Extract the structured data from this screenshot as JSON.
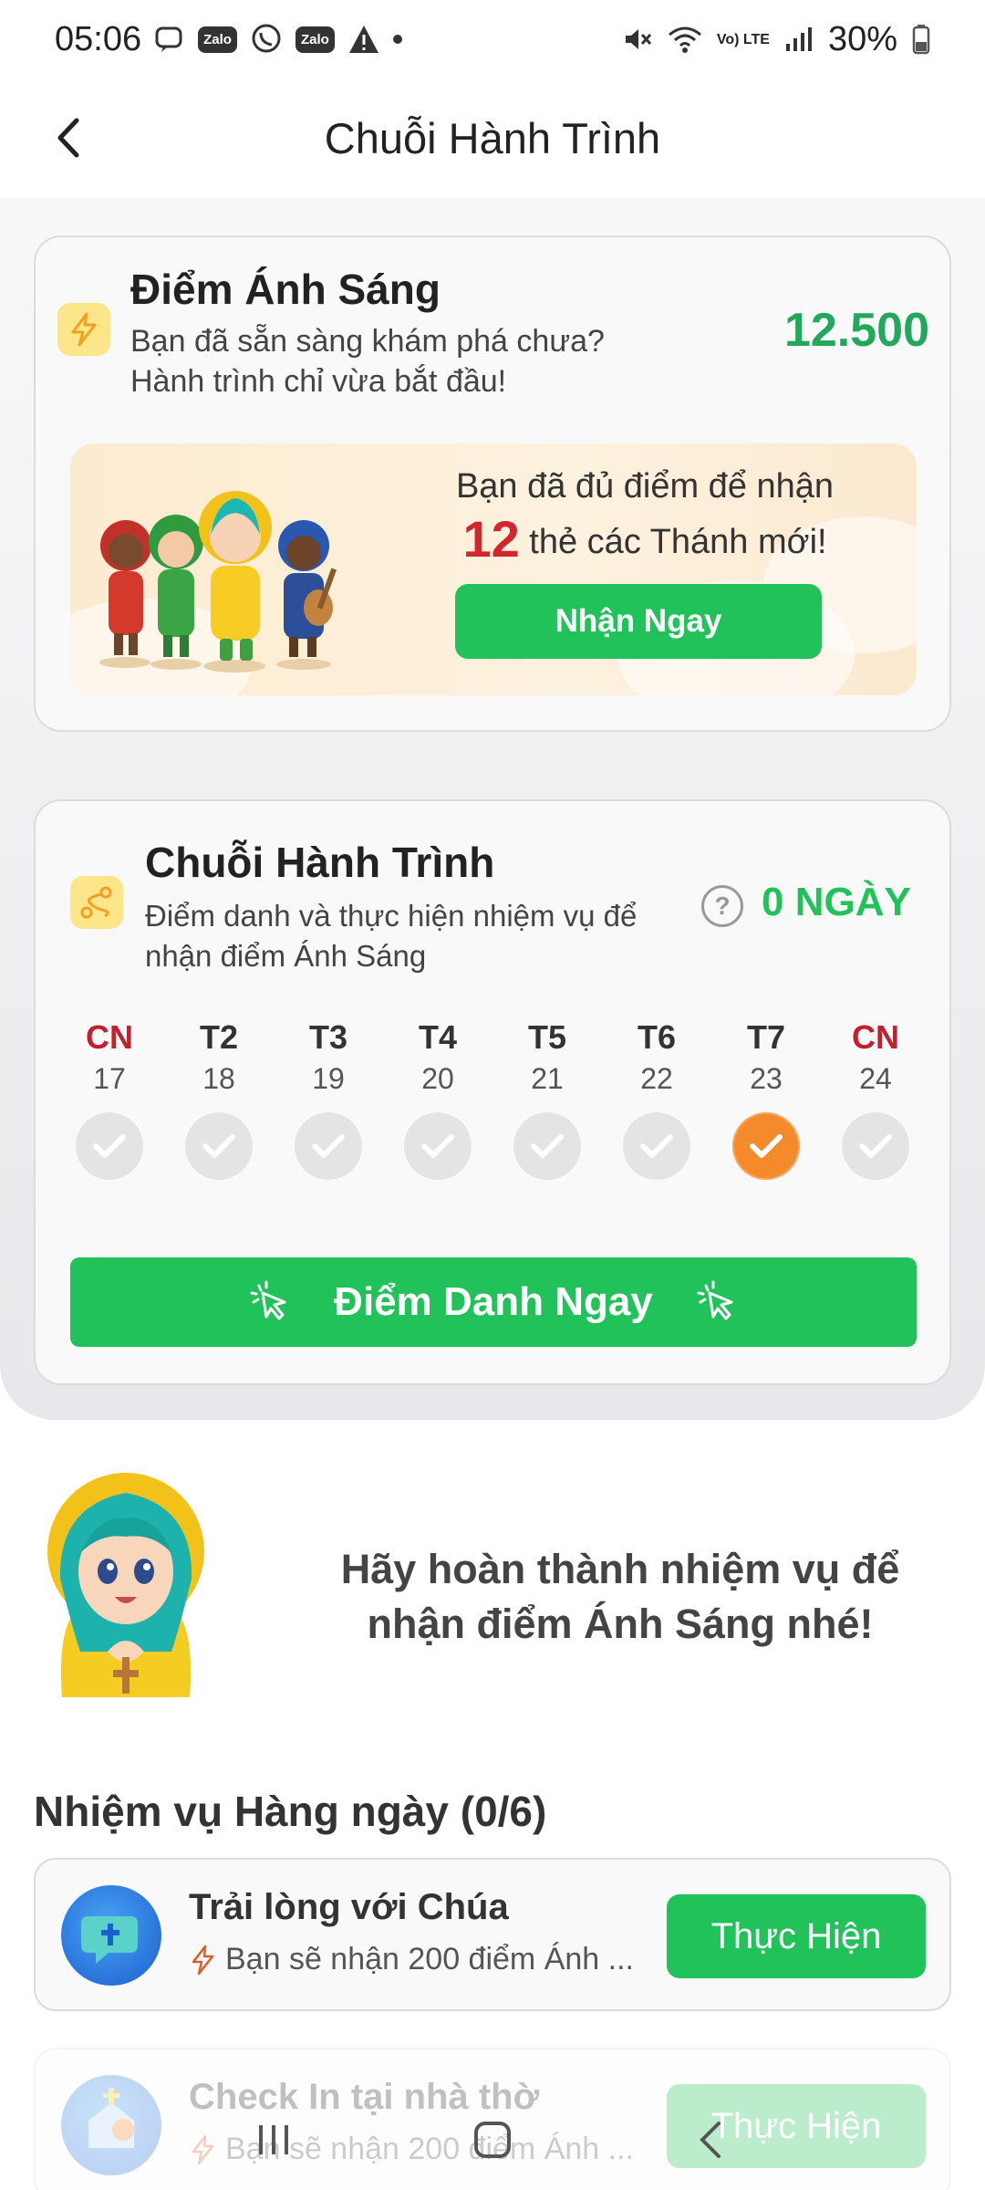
{
  "status_bar": {
    "time": "05:06",
    "notif_zalo_1": "Zalo",
    "notif_zalo_2": "Zalo",
    "volte": "Vo) LTE",
    "battery": "30%"
  },
  "header": {
    "title": "Chuỗi Hành Trình"
  },
  "points_card": {
    "title": "Điểm Ánh Sáng",
    "description": "Bạn đã sẵn sàng khám phá chưa? Hành trình chỉ vừa bắt đầu!",
    "value": "12.500",
    "banner": {
      "line1": "Bạn đã đủ điểm để nhận",
      "count": "12",
      "line2_rest": "thẻ các Thánh mới!",
      "button_label": "Nhận Ngay"
    }
  },
  "streak_card": {
    "title": "Chuỗi Hành Trình",
    "description": "Điểm danh và thực hiện nhiệm vụ để nhận điểm Ánh Sáng",
    "count_label": "0 NGÀY",
    "days": [
      {
        "name": "CN",
        "num": "17",
        "weekend": true,
        "active": false
      },
      {
        "name": "T2",
        "num": "18",
        "weekend": false,
        "active": false
      },
      {
        "name": "T3",
        "num": "19",
        "weekend": false,
        "active": false
      },
      {
        "name": "T4",
        "num": "20",
        "weekend": false,
        "active": false
      },
      {
        "name": "T5",
        "num": "21",
        "weekend": false,
        "active": false
      },
      {
        "name": "T6",
        "num": "22",
        "weekend": false,
        "active": false
      },
      {
        "name": "T7",
        "num": "23",
        "weekend": false,
        "active": true
      },
      {
        "name": "CN",
        "num": "24",
        "weekend": true,
        "active": false
      }
    ],
    "checkin_label": "Điểm Danh Ngay"
  },
  "encourage": {
    "text": "Hãy hoàn thành nhiệm vụ để nhận điểm Ánh Sáng nhé!"
  },
  "daily_tasks": {
    "title": "Nhiệm vụ Hàng ngày (0/6)",
    "items": [
      {
        "title": "Trải lòng với Chúa",
        "subtitle": "Bạn sẽ nhận 200 điểm Ánh ...",
        "button": "Thực Hiện"
      },
      {
        "title": "Check In tại nhà thờ",
        "subtitle": "Bạn sẽ nhận 200 điểm Ánh ...",
        "button": "Thực Hiện"
      }
    ]
  },
  "colors": {
    "accent_green": "#22c25a",
    "points_green": "#22a85a",
    "weekend_red": "#c41f2f",
    "active_orange": "#f58a2c"
  }
}
